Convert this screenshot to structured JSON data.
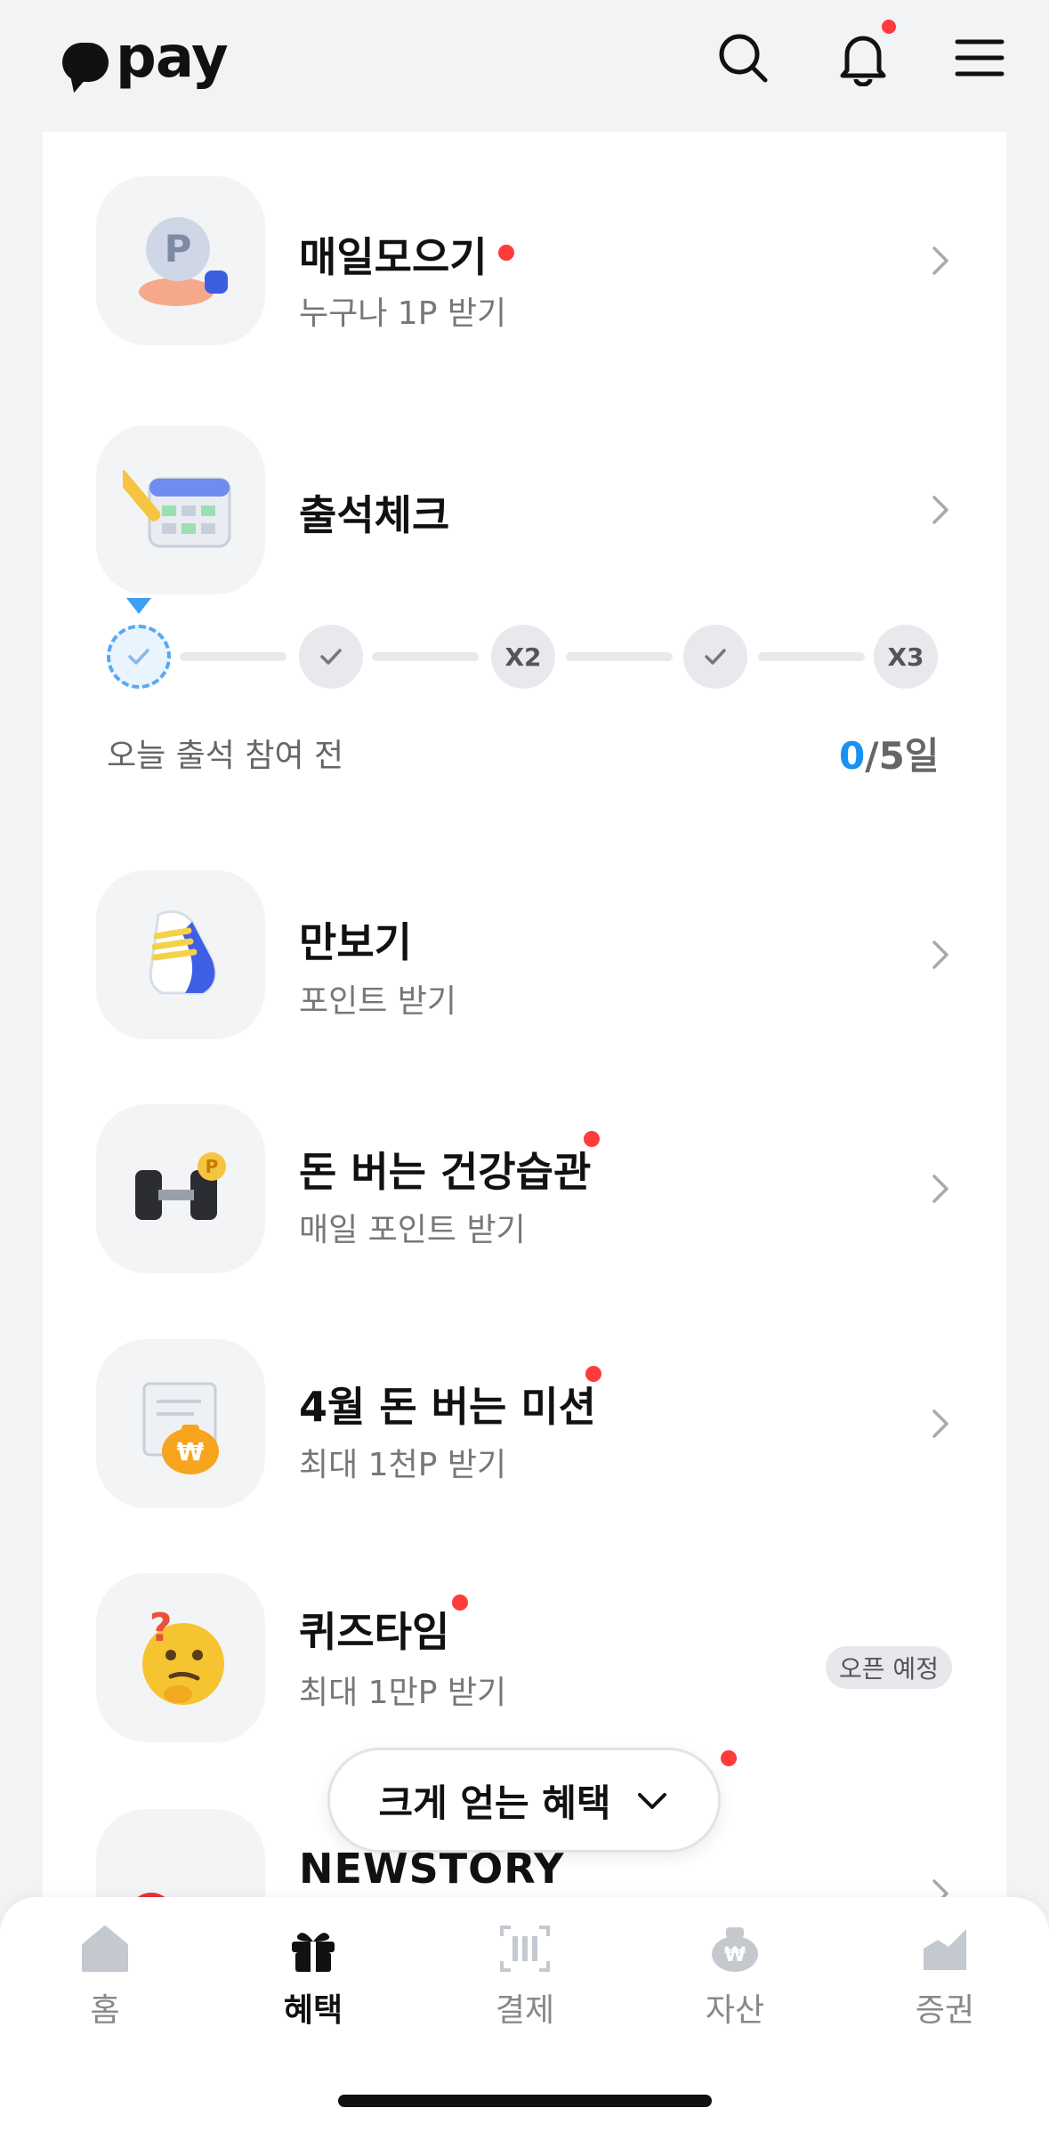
{
  "header": {
    "logo_text": "pay",
    "icons": [
      "search-icon",
      "bell-icon",
      "menu-icon"
    ]
  },
  "items": [
    {
      "title": "매일모으기",
      "sub": "누구나 1P 받기",
      "dot": true,
      "icon": "coin-hand-icon"
    },
    {
      "title": "출석체크",
      "sub": "",
      "dot": false,
      "icon": "calendar-pencil-icon"
    },
    {
      "title": "만보기",
      "sub": "포인트 받기",
      "dot": false,
      "icon": "sneaker-icon"
    },
    {
      "title": "돈 버는 건강습관",
      "sub": "매일 포인트 받기",
      "dot": true,
      "icon": "dumbbell-icon"
    },
    {
      "title": "4월 돈 버는 미션",
      "sub": "최대 1천P 받기",
      "dot": true,
      "icon": "money-bag-icon"
    },
    {
      "title": "퀴즈타임",
      "sub": "최대 1만P 받기",
      "dot": true,
      "icon": "thinking-face-icon",
      "badge": "오픈 예정"
    },
    {
      "title": "NEWSTORY",
      "sub": "",
      "dot": false,
      "icon": "new-badge-icon"
    }
  ],
  "attendance": {
    "nodes": [
      "",
      "",
      "X2",
      "",
      "X3"
    ],
    "status": "오늘 출석 참여 전",
    "current": "0",
    "separator": "/",
    "total": "5일",
    "current_day": 0,
    "accent": "#1a90f0"
  },
  "pill": {
    "label": "크게 얻는 혜택"
  },
  "tabs": [
    {
      "label": "홈",
      "icon": "home-icon",
      "active": false
    },
    {
      "label": "혜택",
      "icon": "gift-icon",
      "active": true
    },
    {
      "label": "결제",
      "icon": "barcode-scan-icon",
      "active": false
    },
    {
      "label": "자산",
      "icon": "won-bag-icon",
      "active": false
    },
    {
      "label": "증권",
      "icon": "chart-icon",
      "active": false
    }
  ]
}
